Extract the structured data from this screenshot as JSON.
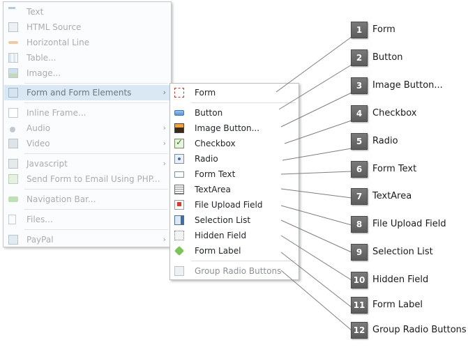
{
  "main_menu": {
    "items": [
      {
        "label": "Text",
        "icon": "text-icon"
      },
      {
        "label": "HTML Source",
        "icon": "html-source-icon"
      },
      {
        "label": "Horizontal Line",
        "icon": "horizontal-line-icon"
      },
      {
        "label": "Table...",
        "icon": "table-icon"
      },
      {
        "label": "Image...",
        "icon": "image-icon"
      },
      {
        "label": "Form and Form Elements",
        "icon": "form-icon",
        "has_submenu": true,
        "highlighted": true
      },
      {
        "label": "Inline Frame...",
        "icon": "inline-frame-icon"
      },
      {
        "label": "Audio",
        "icon": "audio-icon",
        "has_submenu": true
      },
      {
        "label": "Video",
        "icon": "video-icon",
        "has_submenu": true
      },
      {
        "label": "Javascript",
        "icon": "javascript-icon",
        "has_submenu": true
      },
      {
        "label": "Send Form to Email Using PHP...",
        "icon": "send-email-icon"
      },
      {
        "label": "Navigation Bar...",
        "icon": "navigation-bar-icon"
      },
      {
        "label": "Files...",
        "icon": "files-icon"
      },
      {
        "label": "PayPal",
        "icon": "paypal-icon",
        "has_submenu": true
      }
    ],
    "arrow_glyph": "›"
  },
  "submenu": {
    "items": [
      {
        "label": "Form",
        "icon": "form-icon"
      },
      {
        "label": "Button",
        "icon": "button-icon"
      },
      {
        "label": "Image Button...",
        "icon": "image-button-icon"
      },
      {
        "label": "Checkbox",
        "icon": "checkbox-icon"
      },
      {
        "label": "Radio",
        "icon": "radio-icon"
      },
      {
        "label": "Form Text",
        "icon": "form-text-icon"
      },
      {
        "label": "TextArea",
        "icon": "textarea-icon"
      },
      {
        "label": "File Upload Field",
        "icon": "file-upload-icon"
      },
      {
        "label": "Selection List",
        "icon": "selection-list-icon"
      },
      {
        "label": "Hidden Field",
        "icon": "hidden-field-icon"
      },
      {
        "label": "Form Label",
        "icon": "form-label-icon"
      },
      {
        "label": "Group Radio Buttons",
        "icon": "group-radio-icon",
        "disabled": true
      }
    ]
  },
  "callouts": [
    {
      "number": "1",
      "label": "Form"
    },
    {
      "number": "2",
      "label": "Button"
    },
    {
      "number": "3",
      "label": "Image Button..."
    },
    {
      "number": "4",
      "label": "Checkbox"
    },
    {
      "number": "5",
      "label": "Radio"
    },
    {
      "number": "6",
      "label": "Form Text"
    },
    {
      "number": "7",
      "label": "TextArea"
    },
    {
      "number": "8",
      "label": "File Upload Field"
    },
    {
      "number": "9",
      "label": "Selection List"
    },
    {
      "number": "10",
      "label": "Hidden Field"
    },
    {
      "number": "11",
      "label": "Form Label"
    },
    {
      "number": "12",
      "label": "Group Radio Buttons"
    }
  ],
  "colors": {
    "highlight": "#dae8f4",
    "badge": "#666666",
    "leader_line": "#7f7f7f",
    "disabled_text": "#a9adb2"
  }
}
